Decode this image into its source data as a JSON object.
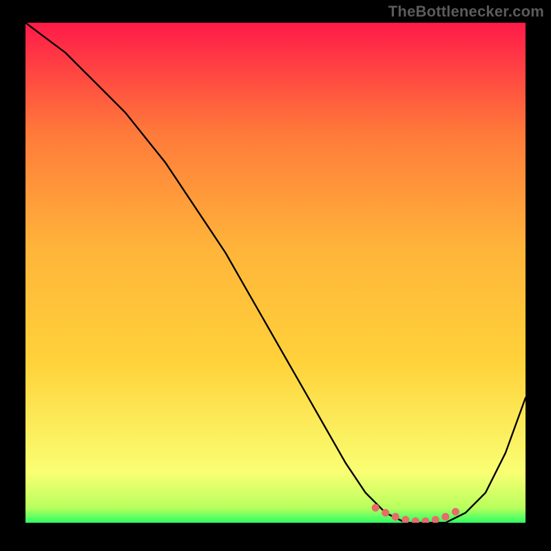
{
  "attribution": "TheBottlenecker.com",
  "colors": {
    "page_bg": "#000000",
    "grad_top": "#ff1a49",
    "grad_mid_upper": "#ff7a3a",
    "grad_mid": "#ffd23a",
    "grad_mid_lower": "#ffee4a",
    "grad_lower": "#f9ff73",
    "grad_bottom": "#2dff63",
    "curve_stroke": "#000000",
    "marker_fill": "#e86a6a",
    "attribution_text": "#5b5b5b"
  },
  "chart_data": {
    "type": "line",
    "title": "",
    "xlabel": "",
    "ylabel": "",
    "xlim": [
      0,
      100
    ],
    "ylim": [
      0,
      100
    ],
    "series": [
      {
        "name": "bottleneck-curve",
        "x": [
          0,
          4,
          8,
          12,
          16,
          20,
          24,
          28,
          32,
          36,
          40,
          44,
          48,
          52,
          56,
          60,
          64,
          68,
          72,
          76,
          80,
          84,
          88,
          92,
          96,
          100
        ],
        "y": [
          100,
          97,
          94,
          90,
          86,
          82,
          77,
          72,
          66,
          60,
          54,
          47,
          40,
          33,
          26,
          19,
          12,
          6,
          2,
          0,
          0,
          0,
          2,
          6,
          14,
          25
        ]
      }
    ],
    "markers": {
      "name": "optimal-range",
      "x": [
        70,
        72,
        74,
        76,
        78,
        80,
        82,
        84,
        86
      ],
      "y": [
        3,
        2,
        1.2,
        0.6,
        0.3,
        0.3,
        0.6,
        1.2,
        2.2
      ]
    }
  }
}
